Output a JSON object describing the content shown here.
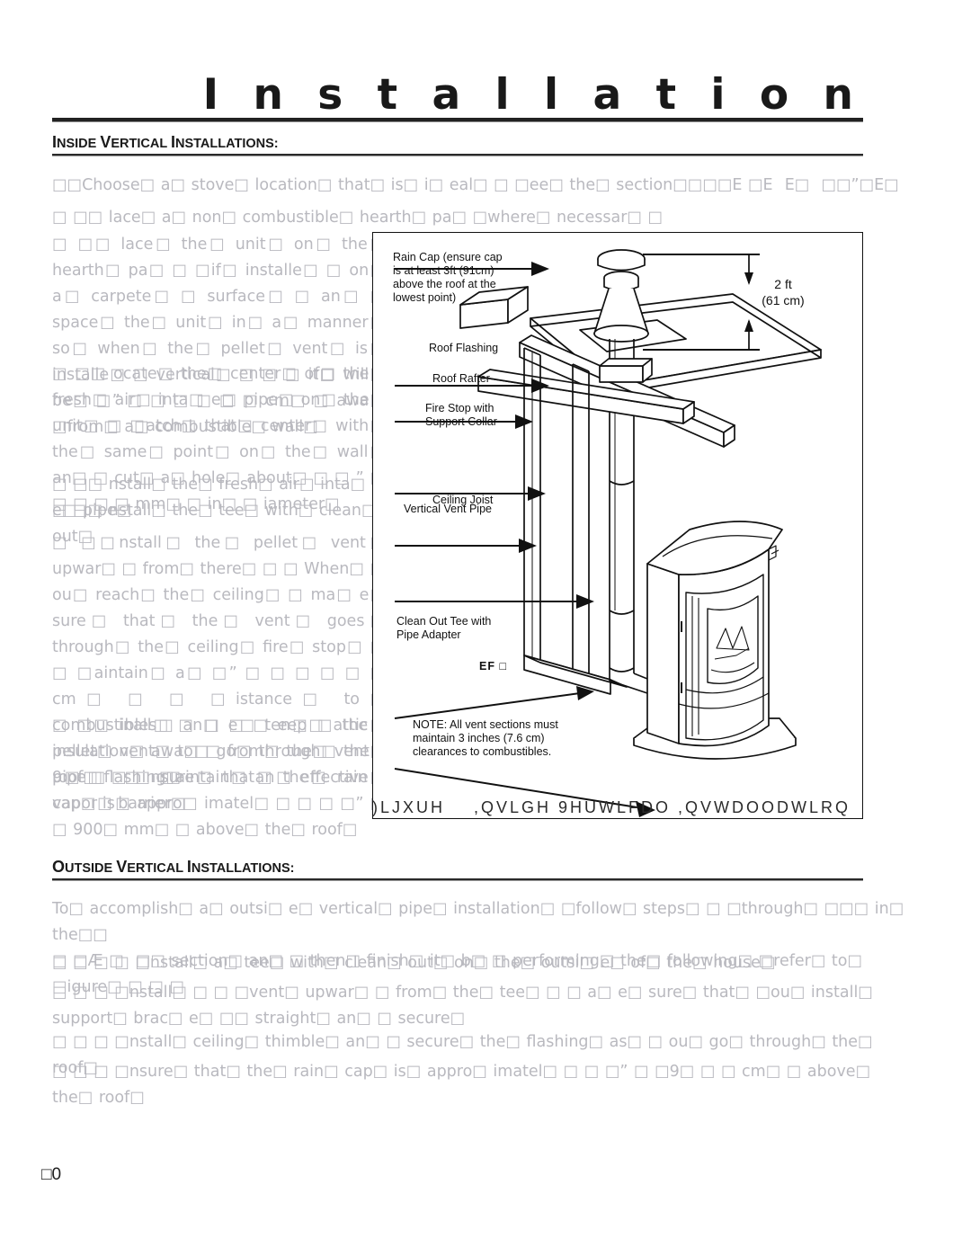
{
  "page": {
    "title": "I n s t a l l a t i o n",
    "number": "□0"
  },
  "sections": {
    "inside": {
      "heading_first": "I",
      "heading_rest": "NSIDE ",
      "heading_word2_first": "V",
      "heading_word2_rest": "ERTICAL ",
      "heading_word3_first": "I",
      "heading_word3_rest": "NSTALLATIONS:"
    },
    "outside": {
      "heading_first": "O",
      "heading_rest": "UTSIDE ",
      "heading_word2_first": "V",
      "heading_word2_rest": "ERTICAL ",
      "heading_word3_first": "I",
      "heading_word3_rest": "NSTALLATIONS:"
    }
  },
  "inside_steps": [
    {
      "name": "step-choose-location",
      "text": "□□Choose□ a□ stove□ location□ that□ is□ i□ eal□ □ □ee□ the□ section□□□□E □E  E□  □□”□E□"
    },
    {
      "name": "step-hearth-pad",
      "text": "□ □□ lace□ a□ non□ combustible□ hearth□ pa□ □where□ necessar□ □"
    },
    {
      "name": "step-place-unit",
      "text": "□ □□ lace□ the□ unit□ on□ the□ hearth□ pa□ □ □if□ installe□ □ on□ a□ carpete□ □ surface□ □ an□ □ space□ the□ unit□ in□ a□ manner□ so□ when□ the□ pellet□ vent□ is□ installe□ □ vertical□ □ □ □ it□ will□ be□ □” □ □ □ □ □ □ cm□ □ awa□ □from□ a□ combustible□ wall□"
    },
    {
      "name": "step-locate-fresh-air",
      "text": "□ □□ ocate□ the□ center□ of□ the□ fresh□ air□ inta□ e□ pipe□ on□ the□ unit□ □ □atch□ that□ center□ with□ the□ same□ point□ on□ the□ wall□ an□ □ cut□ a□ hole□ about□ □ □ ” □ □ □ □ □ mm□ □ in□ □ iameter□"
    },
    {
      "name": "step-install-fresh-air-pipe",
      "text": "□ □□ nstall□ the□ fresh□ air□ inta□ e□ pipe□"
    },
    {
      "name": "step-install-tee",
      "text": "□ □□ nstall□ the□ tee□ with□ clean□ out□"
    },
    {
      "name": "step-install-vent-upward",
      "text": "□ □□nstall□ the□ pellet□ vent□ upwar□ □ from□ there□ □ □ When□ □ ou□ reach□ the□ ceiling□ □ ma□ e□ sure□ that□ the□ vent□ goes□ through□ the□ ceiling□ fire□ stop□ □ □ □aintain□ a□ □” □ □ □ □ □ □ cm□ □ □ □istance□ to□ combustibles□ an□ □ □ eep□ attic□ insulation□ awa□ □ from□ the□ vent□ pipe□ □ □ □aintain□ an□ effective□ vapor□ barrier□"
    },
    {
      "name": "step-extend-vent-roof",
      "text": "□ □□ inall□ □ □ e□ ten□ □ the□ pellet□ vent□ to□ go□ through□ the□ roof□ flashing□"
    },
    {
      "name": "step-rain-cap-height",
      "text": "9□ □  □ nsure□ that□ the□ rain□ cap□ is□ appro□ imatel□ □ □ □ □” □ □ 900□ mm□ □ above□ the□ roof□"
    }
  ],
  "outside_intro": "To□ accomplish□ a□ outsi□ e□ vertical□ pipe□ installation□ □follow□ steps□ □ □through□ □□□ in□ the□□\n□ □Æ □  □□ section□ an□ □ then□ finish□ it□ b□ □ performing□ the□ following□ □refer□ to□ □igure□ □ □ □",
  "outside_steps": [
    {
      "name": "step-outside-install-tee",
      "text": "□ □ □ □ □nstall□ a□ tee□ with□ clean□ out□ on□ the□ outsi□ e□ of□ the□ house□"
    },
    {
      "name": "step-outside-install-vent-upward",
      "text": "□ □ □ □nstall□ □ □ □vent□ upwar□ □ from□ the□ tee□ □ □ a□ e□ sure□ that□ □ou□ install□ support□ brac□ e□ □□ straight□ an□ □ secure□"
    },
    {
      "name": "step-outside-ceiling-thimble",
      "text": "□ □ □ □nstall□ ceiling□ thimble□ an□ □ secure□ the□ flashing□ as□ □ ou□ go□ through□ the□ roof□"
    },
    {
      "name": "step-outside-rain-cap",
      "text": "□ □ □ □nsure□ that□ the□ rain□ cap□ is□ appro□ imatel□ □ □ □” □ □9□ □ □ cm□ □ above□ the□ roof□"
    }
  ],
  "figure": {
    "caption": ")LJXUH    ,QVLGH 9HUWLFDO ,QVWDOODWLRQ",
    "labels": {
      "rain_cap": "Rain Cap (ensure cap\nis at least 3ft (91cm)\nabove the roof at the\nlowest point)",
      "roof_flashing": "Roof Flashing",
      "roof_rafter": "Roof Rafter",
      "fire_stop": "Fire Stop with\nSupport Collar",
      "ceiling_joist": "Ceiling Joist",
      "vertical_vent_pipe": "Vertical Vent Pipe",
      "clean_out_tee": "Clean Out Tee with\nPipe Adapter",
      "ef_label": "EF □",
      "note": "NOTE: All vent sections must\nmaintain 3 inches (7.6 cm)\nclearances to combustibles."
    },
    "dimension": "2 ft\n(61 cm)"
  },
  "colors": {
    "ink": "#1a1a1a",
    "rule": "#222222",
    "missing_glyph": "#b9b9bf"
  }
}
